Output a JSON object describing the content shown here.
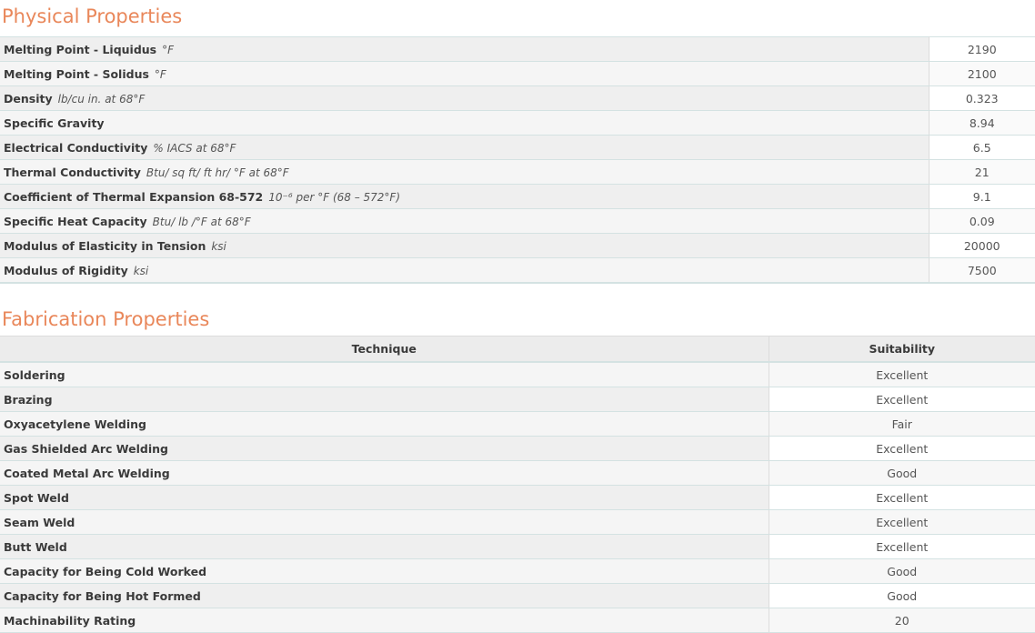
{
  "physical": {
    "title": "Physical Properties",
    "rows": [
      {
        "name": "Melting Point - Liquidus",
        "unit": "°F",
        "value": "2190"
      },
      {
        "name": "Melting Point - Solidus",
        "unit": "°F",
        "value": "2100"
      },
      {
        "name": "Density",
        "unit": "lb/cu in. at 68°F",
        "value": "0.323"
      },
      {
        "name": "Specific Gravity",
        "unit": "",
        "value": "8.94"
      },
      {
        "name": "Electrical Conductivity",
        "unit": "% IACS at 68°F",
        "value": "6.5"
      },
      {
        "name": "Thermal Conductivity",
        "unit": "Btu/ sq ft/ ft hr/ °F at 68°F",
        "value": "21"
      },
      {
        "name": "Coefficient of Thermal Expansion 68-572",
        "unit": "10⁻⁶ per °F (68 – 572°F)",
        "value": "9.1"
      },
      {
        "name": "Specific Heat Capacity",
        "unit": "Btu/ lb /°F at 68°F",
        "value": "0.09"
      },
      {
        "name": "Modulus of Elasticity in Tension",
        "unit": "ksi",
        "value": "20000"
      },
      {
        "name": "Modulus of Rigidity",
        "unit": "ksi",
        "value": "7500"
      }
    ]
  },
  "fabrication": {
    "title": "Fabrication Properties",
    "headers": {
      "technique": "Technique",
      "suitability": "Suitability"
    },
    "rows": [
      {
        "name": "Soldering",
        "value": "Excellent"
      },
      {
        "name": "Brazing",
        "value": "Excellent"
      },
      {
        "name": "Oxyacetylene Welding",
        "value": "Fair"
      },
      {
        "name": "Gas Shielded Arc Welding",
        "value": "Excellent"
      },
      {
        "name": "Coated Metal Arc Welding",
        "value": "Good"
      },
      {
        "name": "Spot Weld",
        "value": "Excellent"
      },
      {
        "name": "Seam Weld",
        "value": "Excellent"
      },
      {
        "name": "Butt Weld",
        "value": "Excellent"
      },
      {
        "name": "Capacity for Being Cold Worked",
        "value": "Good"
      },
      {
        "name": "Capacity for Being Hot Formed",
        "value": "Good"
      },
      {
        "name": "Machinability Rating",
        "value": "20"
      }
    ]
  }
}
